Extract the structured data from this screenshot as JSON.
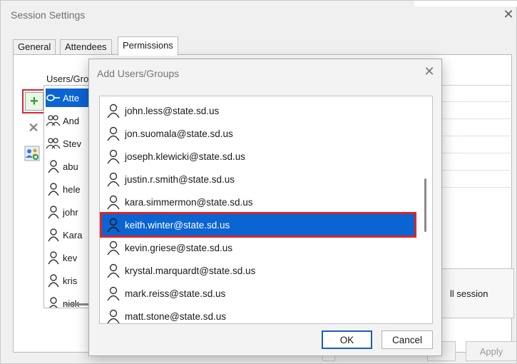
{
  "main": {
    "title": "Session Settings",
    "close": "✕",
    "tabs": [
      {
        "label": "General"
      },
      {
        "label": "Attendees"
      },
      {
        "label": "Permissions"
      }
    ],
    "users_header": "Users/Gro",
    "users": [
      {
        "label": "Atte",
        "icon": "key-icon"
      },
      {
        "label": "And",
        "icon": "group-icon"
      },
      {
        "label": "Stev",
        "icon": "group-icon"
      },
      {
        "label": "abu",
        "icon": "user-icon"
      },
      {
        "label": "hele",
        "icon": "user-icon"
      },
      {
        "label": "johr",
        "icon": "user-icon"
      },
      {
        "label": "Kara",
        "icon": "user-icon"
      },
      {
        "label": "kev",
        "icon": "user-icon"
      },
      {
        "label": "kris",
        "icon": "user-icon"
      },
      {
        "label": "nick",
        "icon": "user-icon"
      }
    ],
    "session_text": "ll session",
    "apply_label": "Apply"
  },
  "dialog": {
    "title": "Add Users/Groups",
    "close": "✕",
    "items": [
      "john.less@state.sd.us",
      "jon.suomala@state.sd.us",
      "joseph.klewicki@state.sd.us",
      "justin.r.smith@state.sd.us",
      "kara.simmermon@state.sd.us",
      "keith.winter@state.sd.us",
      "kevin.griese@state.sd.us",
      "krystal.marquardt@state.sd.us",
      "mark.reiss@state.sd.us",
      "matt.stone@state.sd.us"
    ],
    "selected_index": 5,
    "ok_label": "OK",
    "cancel_label": "Cancel"
  },
  "colors": {
    "selection": "#0a64d2",
    "highlight_box": "#d8262c",
    "add_icon": "#2d9b2d"
  }
}
